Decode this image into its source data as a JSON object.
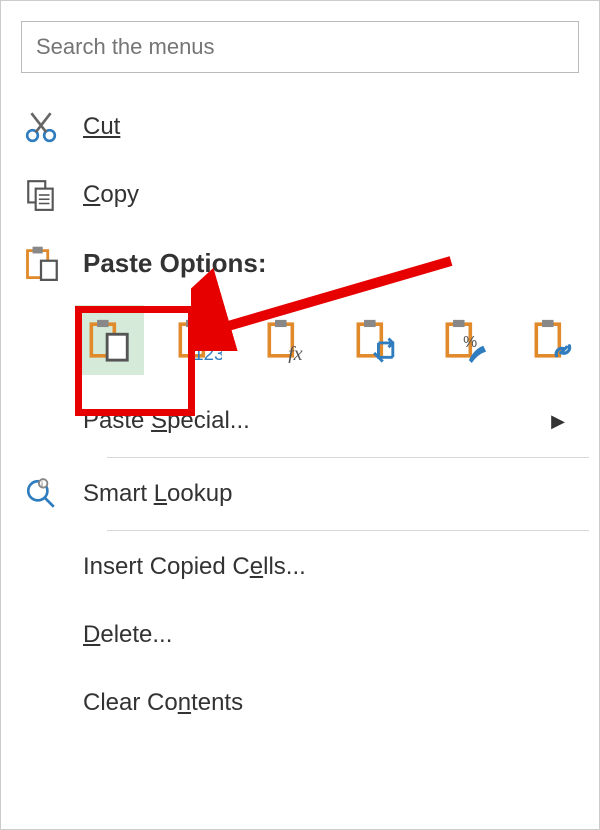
{
  "search": {
    "placeholder": "Search the menus"
  },
  "menu": {
    "cut": "Cut",
    "copy": "Copy",
    "paste_options_label": "Paste Options:",
    "paste_special": "Paste Special...",
    "smart_lookup": "Smart Lookup",
    "insert_copied_cells": "Insert Copied Cells...",
    "delete": "Delete...",
    "clear_contents": "Clear Contents"
  },
  "paste_icons": [
    "paste-default",
    "paste-values-123",
    "paste-formulas-fx",
    "paste-transpose",
    "paste-formatting-percent",
    "paste-link"
  ]
}
